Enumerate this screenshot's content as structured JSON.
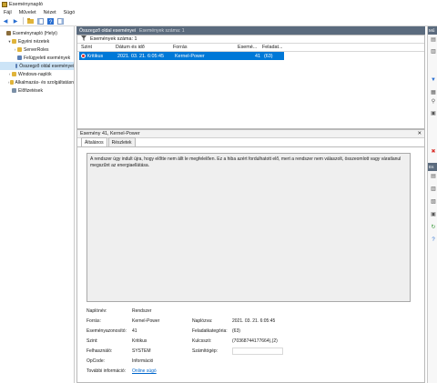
{
  "window": {
    "title": "Eseménynapló"
  },
  "menu": [
    "Fájl",
    "Művelet",
    "Nézet",
    "Súgó"
  ],
  "tree": {
    "items": [
      {
        "label": "Eseménynapló (Helyi)",
        "level": 0,
        "expander": "",
        "icon": "event-viewer-icon",
        "color": "#8a6d3b"
      },
      {
        "label": "Egyéni nézetek",
        "level": 1,
        "expander": "▾",
        "icon": "folder-icon",
        "color": "#e0b43a"
      },
      {
        "label": "ServerRoles",
        "level": 2,
        "expander": "›",
        "icon": "folder-icon",
        "color": "#e0b43a"
      },
      {
        "label": "Felügyeleti események",
        "level": 2,
        "expander": "",
        "icon": "filter-icon",
        "color": "#5b7fb5"
      },
      {
        "label": "Összegző oldal eseményei",
        "level": 2,
        "expander": "",
        "icon": "filter-icon",
        "color": "#5b7fb5",
        "selected": true
      },
      {
        "label": "Windows-naplók",
        "level": 1,
        "expander": "›",
        "icon": "folder-icon",
        "color": "#e0b43a"
      },
      {
        "label": "Alkalmazás- és szolgáltatásn",
        "level": 1,
        "expander": "›",
        "icon": "folder-icon",
        "color": "#e0b43a"
      },
      {
        "label": "Előfizetések",
        "level": 1,
        "expander": "",
        "icon": "subscriptions-icon",
        "color": "#7a8fa6"
      }
    ]
  },
  "center": {
    "header_title": "Összegző oldal eseményei",
    "header_count": "Események száma: 1",
    "count_label": "Események száma: 1",
    "columns": [
      "Szint",
      "Dátum és idő",
      "Forrás",
      "Esemé...",
      "Feladat..."
    ],
    "rows": [
      {
        "level": "Kritikus",
        "datetime": "2021. 03. 21. 6:05:45",
        "source": "Kernel-Power",
        "event_id": "41",
        "task": "(63)"
      }
    ]
  },
  "detail": {
    "title": "Esemény 41, Kernel-Power",
    "close": "✕",
    "tabs": [
      "Általános",
      "Részletek"
    ],
    "message": "A rendszer úgy indult újra, hogy előtte nem állt le megfelelően. Ez a hiba azért fordulhatott elő, mert a rendszer nem válaszolt, összeomlott vagy váratlanul megszűnt az energiaellátása.",
    "props": {
      "naplonev_label": "Naplónév:",
      "naplonev": "Rendszer",
      "forras_label": "Forrás:",
      "forras": "Kernel-Power",
      "naplozva_label": "Naplózva:",
      "naplozva": "2021. 03. 21. 6:05:45",
      "esemenyazonosito_label": "Eseményazonosító:",
      "esemenyazonosito": "41",
      "feladatkategoria_label": "Feladatkategória:",
      "feladatkategoria": "(63)",
      "szint_label": "Szint:",
      "szint": "Kritikus",
      "kulcsszo_label": "Kulcsszó:",
      "kulcsszo": "(70368744177664),(2)",
      "felhasznalo_label": "Felhasználó:",
      "felhasznalo": "SYSTEM",
      "szamitogep_label": "Számítógép:",
      "opcode_label": "OpCode:",
      "opcode": "Információ",
      "tovabbi_label": "További információ:",
      "tovabbi_link": "Online súgó"
    }
  },
  "actions": {
    "header1": "Mű",
    "header2": "Es"
  }
}
